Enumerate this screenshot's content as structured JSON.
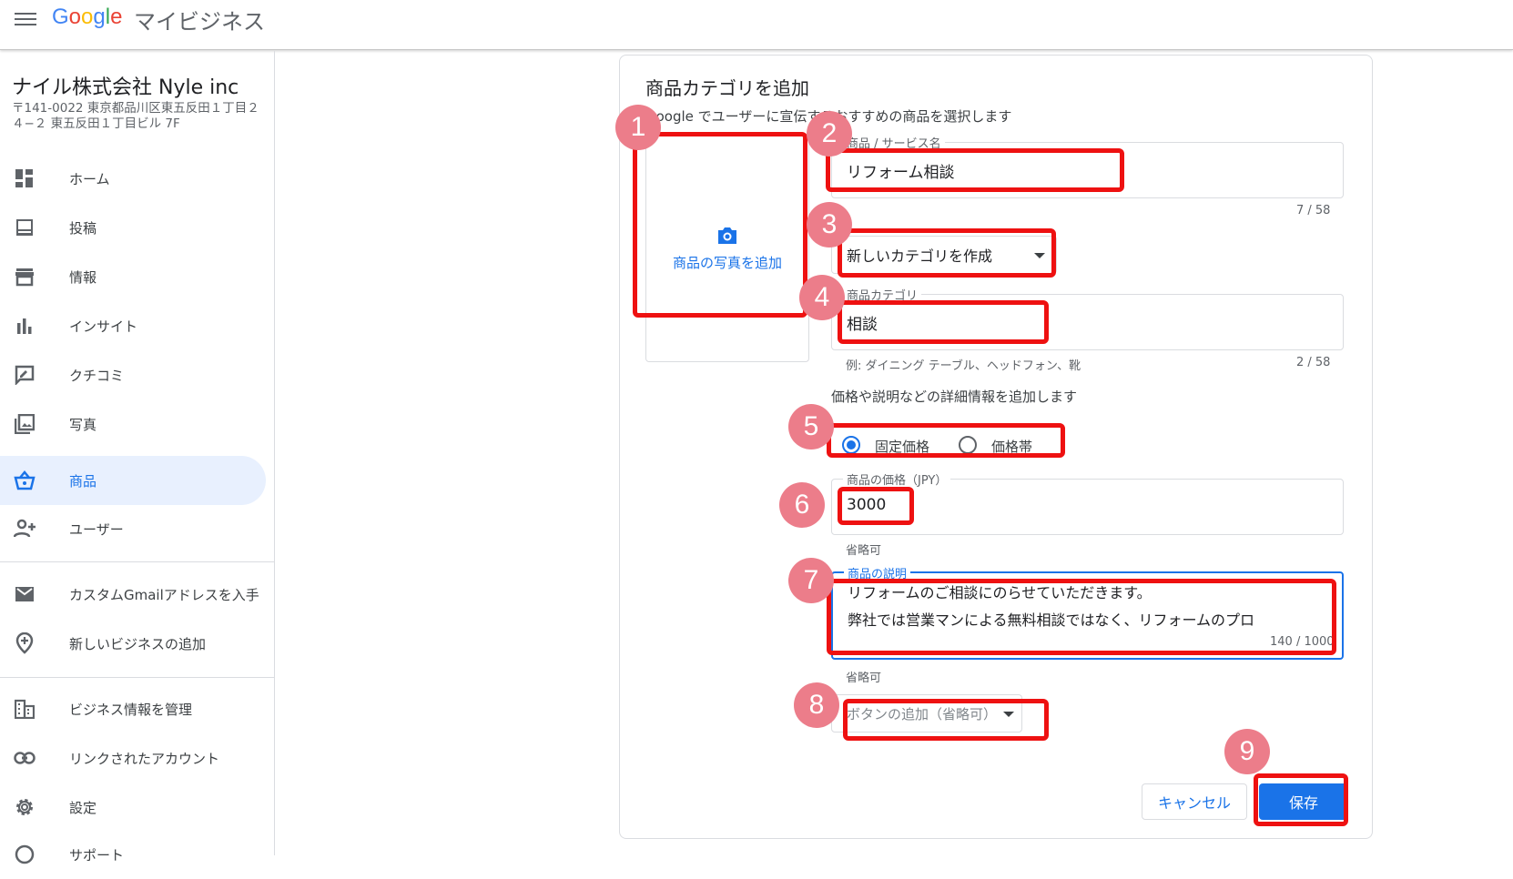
{
  "header": {
    "logo_letters": [
      "G",
      "o",
      "o",
      "g",
      "l",
      "e"
    ],
    "product": "マイビジネス"
  },
  "sidebar": {
    "business_name": "ナイル株式会社 Nyle inc",
    "address": "〒141-0022 東京都品川区東五反田１丁目２４−２ 東五反田１丁目ビル 7F",
    "items": [
      {
        "label": "ホーム",
        "icon": "dashboard-icon"
      },
      {
        "label": "投稿",
        "icon": "posts-icon"
      },
      {
        "label": "情報",
        "icon": "storefront-icon"
      },
      {
        "label": "インサイト",
        "icon": "insights-bar-icon"
      },
      {
        "label": "クチコミ",
        "icon": "reviews-icon"
      },
      {
        "label": "写真",
        "icon": "photos-icon"
      },
      {
        "label": "商品",
        "icon": "basket-icon"
      },
      {
        "label": "ユーザー",
        "icon": "add-person-icon"
      },
      {
        "label": "カスタムGmailアドレスを入手",
        "icon": "mail-icon"
      },
      {
        "label": "新しいビジネスの追加",
        "icon": "add-location-icon"
      },
      {
        "label": "ビジネス情報を管理",
        "icon": "business-icon"
      },
      {
        "label": "リンクされたアカウント",
        "icon": "link-icon"
      },
      {
        "label": "設定",
        "icon": "gear-icon"
      },
      {
        "label": "サポート",
        "icon": "help-icon"
      }
    ]
  },
  "form": {
    "title": "商品カテゴリを追加",
    "subtitle": "Google でユーザーに宣伝するおすすめの商品を選択します",
    "photo_label": "商品の写真を追加",
    "name_label": "商品 / サービス名",
    "name_value": "リフォーム相談",
    "name_counter": "7 / 58",
    "category_select": "新しいカテゴリを作成",
    "category_label": "商品カテゴリ",
    "category_value": "相談",
    "category_hint": "例: ダイニング テーブル、ヘッドフォン、靴",
    "category_counter": "2 / 58",
    "details_heading": "価格や説明などの詳細情報を追加します",
    "radio_fixed": "固定価格",
    "radio_range": "価格帯",
    "price_label": "商品の価格（JPY）",
    "price_value": "3000",
    "optional": "省略可",
    "desc_label": "商品の説明",
    "desc_line1": "リフォームのご相談にのらせていただきます。",
    "desc_line2": "弊社では営業マンによる無料相談ではなく、リフォームのプロ",
    "desc_counter": "140 / 1000",
    "button_select": "ボタンの追加（省略可）",
    "cancel": "キャンセル",
    "save": "保存"
  },
  "annotations": [
    "1",
    "2",
    "3",
    "4",
    "5",
    "6",
    "7",
    "8",
    "9"
  ],
  "colors": {
    "accent": "#1a73e8",
    "annotation_box": "#ee1111",
    "annotation_marker": "#ec7d8a"
  }
}
